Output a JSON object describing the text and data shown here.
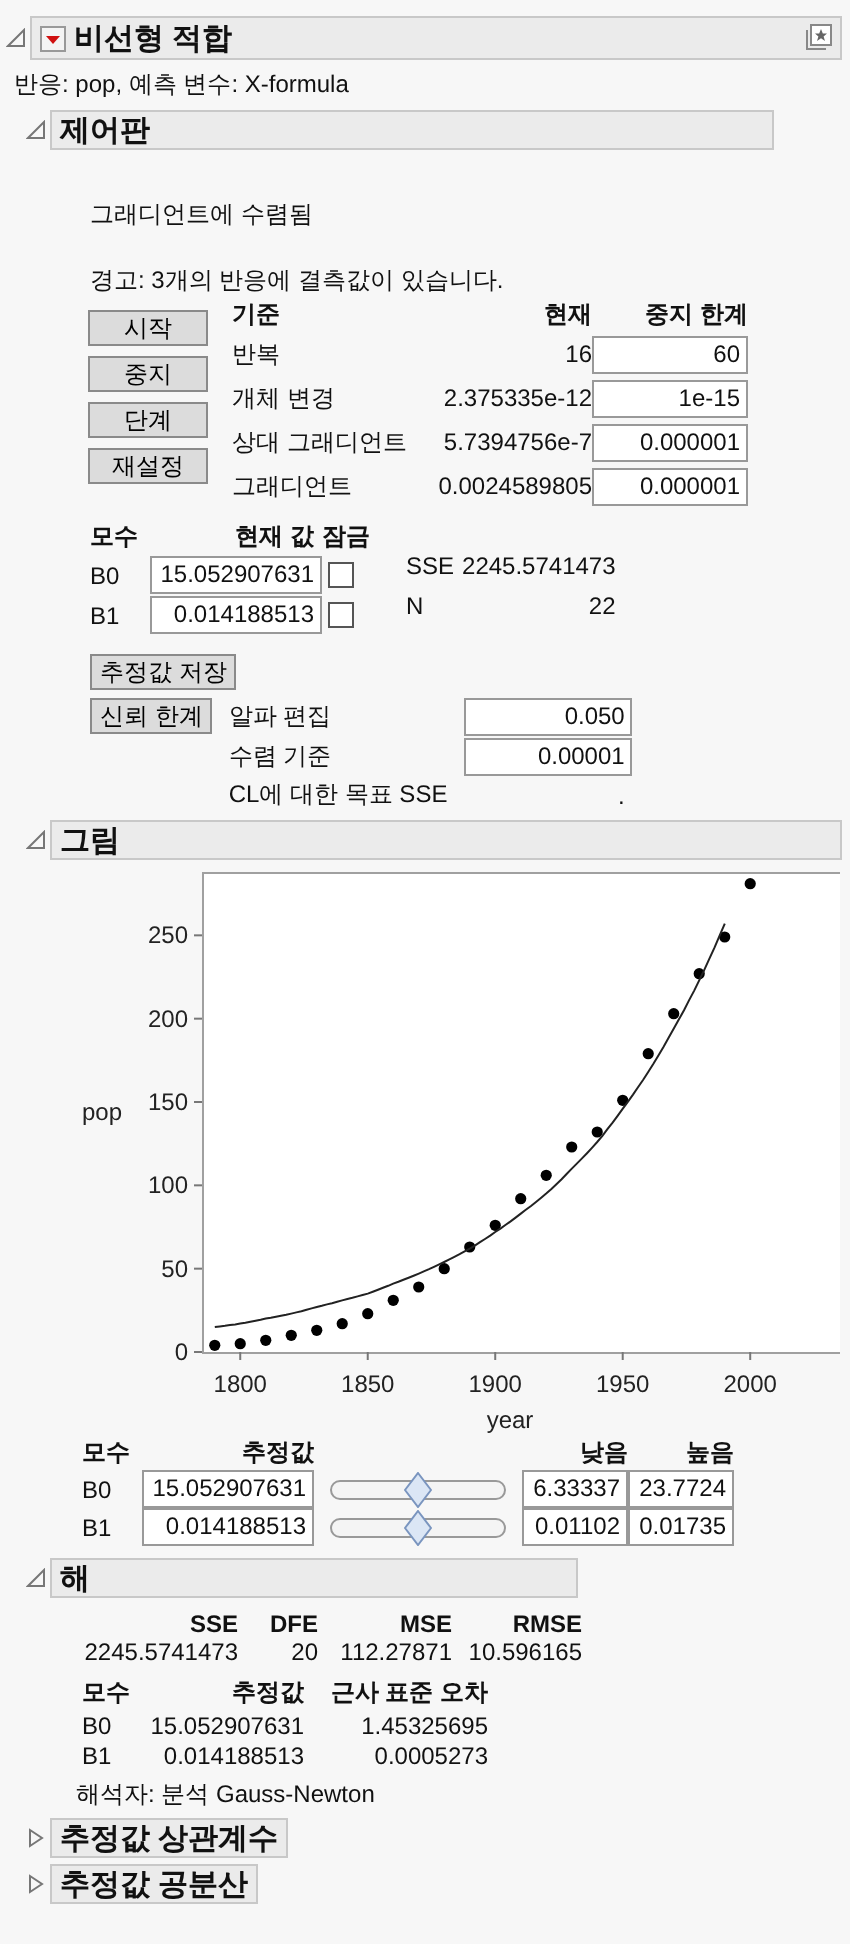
{
  "report": {
    "title": "비선형 적합",
    "response_line": "반응: pop, 예측 변수: X-formula"
  },
  "control_panel": {
    "title": "제어판",
    "expanded": true,
    "status": "그래디언트에 수렴됨",
    "warning": "경고: 3개의 반응에 결측값이 있습니다.",
    "buttons": [
      "시작",
      "중지",
      "단계",
      "재설정"
    ],
    "criteria_columns": [
      "기준",
      "현재",
      "중지 한계"
    ],
    "criteria": [
      {
        "name": "반복",
        "current": "16",
        "limit": "60"
      },
      {
        "name": "개체 변경",
        "current": "2.375335e-12",
        "limit": "1e-15"
      },
      {
        "name": "상대 그래디언트",
        "current": "5.7394756e-7",
        "limit": "0.000001"
      },
      {
        "name": "그래디언트",
        "current": "0.0024589805",
        "limit": "0.000001"
      }
    ],
    "param_columns": [
      "모수",
      "현재 값",
      "잠금"
    ],
    "params": [
      {
        "name": "B0",
        "value": "15.052907631",
        "locked": false
      },
      {
        "name": "B1",
        "value": "0.014188513",
        "locked": false
      }
    ],
    "stats": [
      {
        "label": "SSE",
        "value": "2245.5741473"
      },
      {
        "label": "N",
        "value": "22"
      }
    ],
    "save_button": "추정값 저장",
    "ci_button": "신뢰 한계",
    "ci_settings": [
      {
        "kind": "field",
        "label": "알파 편집",
        "value": "0.050"
      },
      {
        "kind": "field",
        "label": "수렴 기준",
        "value": "0.00001"
      },
      {
        "kind": "text",
        "label": "CL에 대한 목표 SSE",
        "value": "."
      }
    ]
  },
  "plot": {
    "title": "그림",
    "expanded": true,
    "chart_data": {
      "type": "scatter",
      "xlabel": "year",
      "ylabel": "pop",
      "xlim": [
        1785,
        2036
      ],
      "ylim": [
        0,
        288
      ],
      "xticks": [
        1800,
        1850,
        1900,
        1950,
        2000
      ],
      "yticks": [
        0,
        50,
        100,
        150,
        200,
        250
      ],
      "x": [
        1790,
        1800,
        1810,
        1820,
        1830,
        1840,
        1850,
        1860,
        1870,
        1880,
        1890,
        1900,
        1910,
        1920,
        1930,
        1940,
        1950,
        1960,
        1970,
        1980,
        1990,
        2000
      ],
      "series": [
        {
          "color": "#000000",
          "values": [
            4,
            5,
            7,
            10,
            13,
            17,
            23,
            31,
            39,
            50,
            63,
            76,
            92,
            106,
            123,
            132,
            151,
            179,
            203,
            227,
            249,
            281
          ]
        },
        {
          "type": "line",
          "color": "#222222",
          "values": [
            15,
            17,
            20,
            23,
            27,
            31,
            35,
            41,
            47,
            54,
            62,
            72,
            83,
            95,
            110,
            126,
            146,
            168,
            194,
            223,
            257,
            null
          ]
        }
      ]
    },
    "slider_columns": [
      "모수",
      "추정값",
      "낮음",
      "높음"
    ],
    "sliders": [
      {
        "name": "B0",
        "value": "15.052907631",
        "level": 0.5,
        "low": "6.33337",
        "high": "23.7724"
      },
      {
        "name": "B1",
        "value": "0.014188513",
        "level": 0.5,
        "low": "0.01102",
        "high": "0.01735"
      }
    ]
  },
  "solution": {
    "title": "해",
    "expanded": true,
    "fit_columns": [
      "SSE",
      "DFE",
      "MSE",
      "RMSE"
    ],
    "fit_values": [
      "2245.5741473",
      "20",
      "112.27871",
      "10.596165"
    ],
    "estimate_columns": [
      "모수",
      "추정값",
      "근사 표준 오차"
    ],
    "estimates": [
      {
        "name": "B0",
        "estimate": "15.052907631",
        "std_error": "1.45325695"
      },
      {
        "name": "B1",
        "estimate": "0.014188513",
        "std_error": "0.0005273"
      }
    ],
    "solver": "해석자: 분석 Gauss-Newton"
  },
  "collapsed_sections": [
    {
      "title": "추정값 상관계수",
      "expanded": false
    },
    {
      "title": "추정값 공분산",
      "expanded": false
    }
  ]
}
